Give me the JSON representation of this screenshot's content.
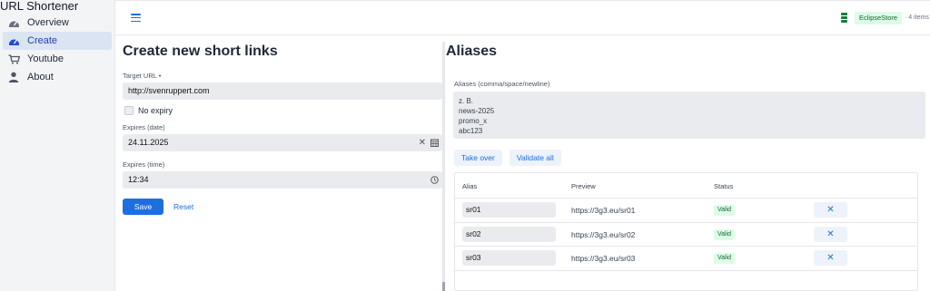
{
  "app": {
    "title": "URL Shortener"
  },
  "sidebar": {
    "items": [
      {
        "label": "Overview",
        "icon": "dashboard-icon",
        "active": false
      },
      {
        "label": "Create",
        "icon": "dashboard-icon",
        "active": true
      },
      {
        "label": "Youtube",
        "icon": "cart-icon",
        "active": false
      },
      {
        "label": "About",
        "icon": "user-icon",
        "active": false
      }
    ]
  },
  "topbar": {
    "store_badge": "EclipseStore",
    "items_count": "· 4 items"
  },
  "create_form": {
    "title": "Create new short links",
    "target_url": {
      "label": "Target URL •",
      "value": "http://svenruppert.com"
    },
    "no_expiry": {
      "label": "No expiry",
      "checked": false
    },
    "expires_date": {
      "label": "Expires (date)",
      "value": "24.11.2025"
    },
    "expires_time": {
      "label": "Expires (time)",
      "value": "12:34"
    },
    "save_label": "Save",
    "reset_label": "Reset"
  },
  "aliases": {
    "title": "Aliases",
    "textarea_label": "Aliases (comma/space/newline)",
    "textarea_lines": [
      "z. B.",
      "news-2025",
      "promo_x",
      "abc123"
    ],
    "take_over_label": "Take over",
    "validate_all_label": "Validate all",
    "grid": {
      "headers": {
        "alias": "Alias",
        "preview": "Preview",
        "status": "Status"
      },
      "rows": [
        {
          "alias": "sr01",
          "preview": "https://3g3.eu/sr01",
          "status": "Valid",
          "remove": "✕"
        },
        {
          "alias": "sr02",
          "preview": "https://3g3.eu/sr02",
          "status": "Valid",
          "remove": "✕"
        },
        {
          "alias": "sr03",
          "preview": "https://3g3.eu/sr03",
          "status": "Valid",
          "remove": "✕"
        }
      ]
    }
  },
  "colors": {
    "accent": "#1d6fe0",
    "valid_bg": "#dcfce7",
    "valid_fg": "#166534"
  }
}
